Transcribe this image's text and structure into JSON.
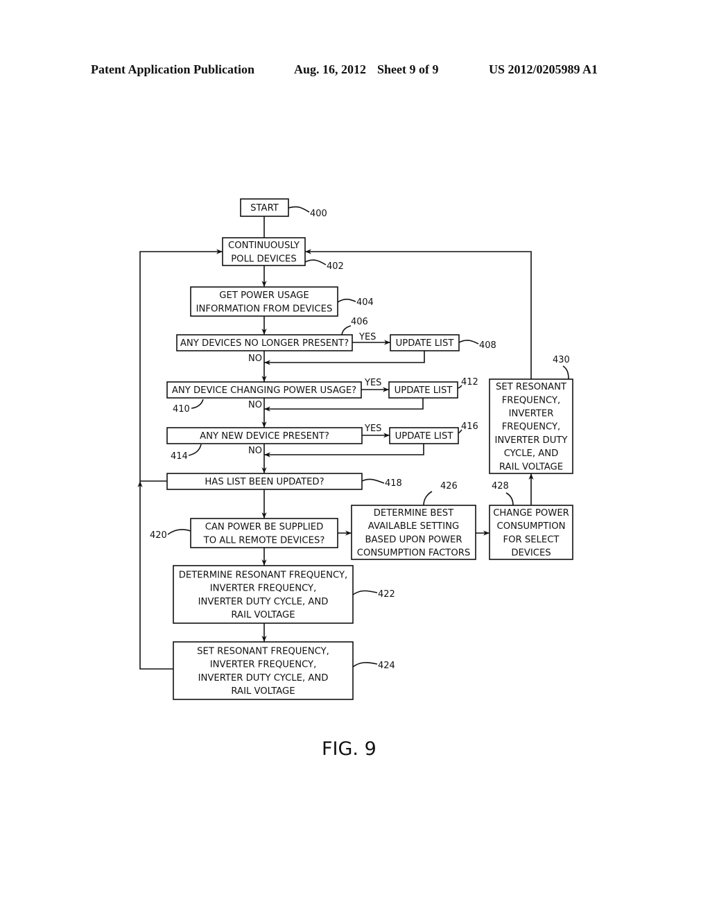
{
  "header": {
    "publication": "Patent Application Publication",
    "date": "Aug. 16, 2012",
    "sheet": "Sheet 9 of 9",
    "number": "US 2012/0205989 A1"
  },
  "figure_label": "FIG. 9",
  "edge_labels": {
    "yes": "YES",
    "no": "NO"
  },
  "nodes": {
    "start": {
      "ref": "400",
      "lines": [
        "START"
      ]
    },
    "poll": {
      "ref": "402",
      "lines": [
        "CONTINUOUSLY",
        "POLL DEVICES"
      ]
    },
    "get_usage": {
      "ref": "404",
      "lines": [
        "GET POWER USAGE",
        "INFORMATION FROM DEVICES"
      ]
    },
    "no_longer_present": {
      "ref": "406",
      "lines": [
        "ANY DEVICES NO LONGER PRESENT?"
      ]
    },
    "update1": {
      "ref": "408",
      "lines": [
        "UPDATE LIST"
      ]
    },
    "changing_usage": {
      "ref": "410",
      "lines": [
        "ANY DEVICE CHANGING POWER USAGE?"
      ]
    },
    "update2": {
      "ref": "412",
      "lines": [
        "UPDATE LIST"
      ]
    },
    "new_device": {
      "ref": "414",
      "lines": [
        "ANY NEW DEVICE PRESENT?"
      ]
    },
    "update3": {
      "ref": "416",
      "lines": [
        "UPDATE LIST"
      ]
    },
    "list_updated": {
      "ref": "418",
      "lines": [
        "HAS LIST BEEN UPDATED?"
      ]
    },
    "can_supply": {
      "ref": "420",
      "lines": [
        "CAN POWER BE SUPPLIED",
        "TO ALL REMOTE DEVICES?"
      ]
    },
    "determine": {
      "ref": "422",
      "lines": [
        "DETERMINE RESONANT FREQUENCY,",
        "INVERTER FREQUENCY,",
        "INVERTER DUTY CYCLE, AND",
        "RAIL VOLTAGE"
      ]
    },
    "set": {
      "ref": "424",
      "lines": [
        "SET RESONANT FREQUENCY,",
        "INVERTER FREQUENCY,",
        "INVERTER DUTY CYCLE, AND",
        "RAIL VOLTAGE"
      ]
    },
    "best_setting": {
      "ref": "426",
      "lines": [
        "DETERMINE BEST",
        "AVAILABLE SETTING",
        "BASED UPON POWER",
        "CONSUMPTION FACTORS"
      ]
    },
    "change_consumption": {
      "ref": "428",
      "lines": [
        "CHANGE POWER",
        "CONSUMPTION",
        "FOR SELECT",
        "DEVICES"
      ]
    },
    "set_alt": {
      "ref": "430",
      "lines": [
        "SET RESONANT",
        "FREQUENCY,",
        "INVERTER",
        "FREQUENCY,",
        "INVERTER DUTY",
        "CYCLE, AND",
        "RAIL VOLTAGE"
      ]
    }
  }
}
